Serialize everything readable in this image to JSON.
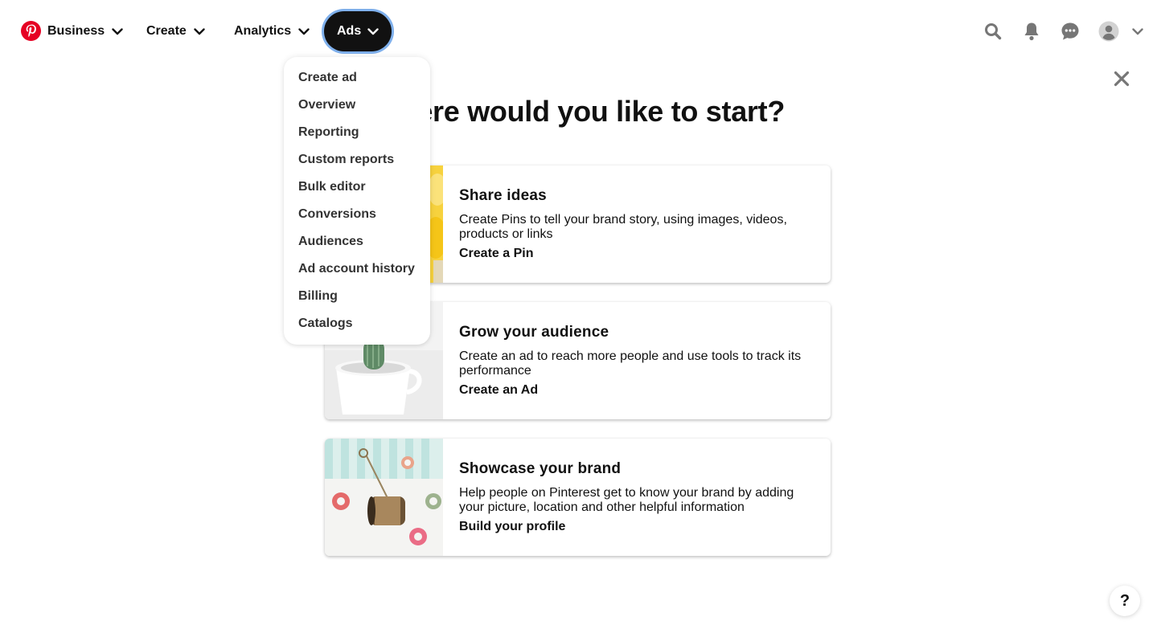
{
  "nav": {
    "business_label": "Business",
    "create_label": "Create",
    "analytics_label": "Analytics",
    "ads_label": "Ads"
  },
  "icons": {
    "logo": "pinterest-logo",
    "search": "search-icon",
    "notifications": "bell-icon",
    "messages": "chat-icon",
    "profile": "avatar",
    "account_menu": "chevron-down-icon",
    "close": "close-icon",
    "help": "help-icon"
  },
  "colors": {
    "brand": "#e60023",
    "active_pill": "#111111",
    "focus_ring": "#7fb0ec",
    "icon_gray": "#767676"
  },
  "ads_menu": {
    "items": [
      "Create ad",
      "Overview",
      "Reporting",
      "Custom reports",
      "Bulk editor",
      "Conversions",
      "Audiences",
      "Ad account history",
      "Billing",
      "Catalogs"
    ]
  },
  "main": {
    "heading": "Where would you like to start?",
    "cards": [
      {
        "title": "Share ideas",
        "description": "Create Pins to tell your brand story, using images, videos, products or links",
        "link": "Create a Pin"
      },
      {
        "title": "Grow your audience",
        "description": "Create an ad to reach more people and use tools to track its performance",
        "link": "Create an Ad"
      },
      {
        "title": "Showcase your brand",
        "description": "Help people on Pinterest get to know your brand by adding your picture, location and other helpful information",
        "link": "Build your profile"
      }
    ]
  },
  "help_label": "?"
}
